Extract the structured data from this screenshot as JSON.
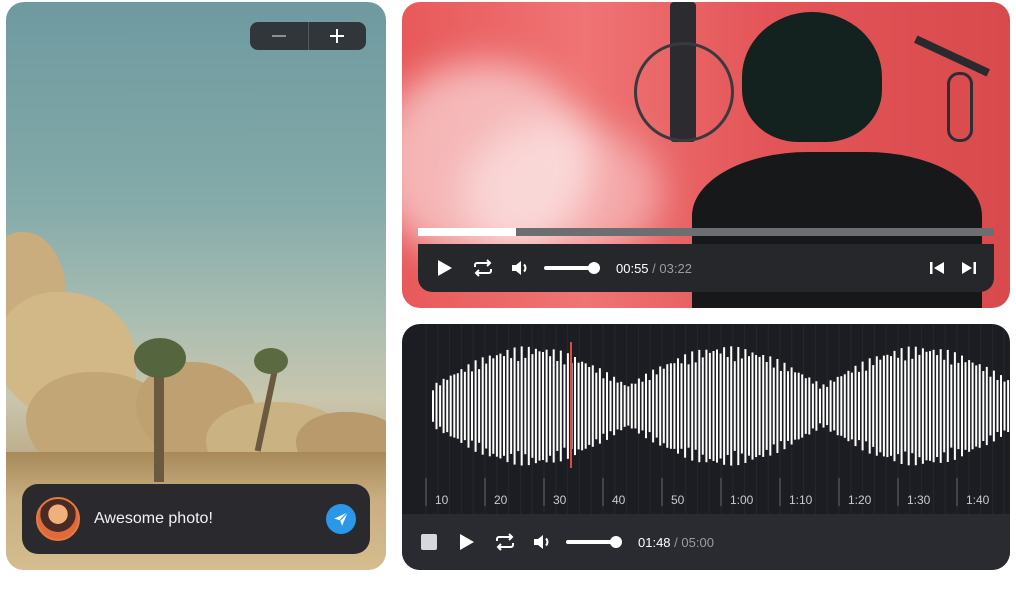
{
  "photo_card": {
    "zoom_out_icon": "minus-icon",
    "zoom_in_icon": "plus-icon",
    "comment": {
      "avatar_icon": "avatar",
      "text": "Awesome photo!",
      "send_icon": "paper-plane-icon",
      "send_color": "#2a97e8"
    }
  },
  "video_player": {
    "progress": 0.17,
    "current_time": "00:55",
    "separator": " / ",
    "duration": "03:22",
    "volume": 0.9,
    "controls": [
      "play-icon",
      "repeat-icon",
      "volume-icon",
      "skip-back-icon",
      "skip-forward-icon"
    ]
  },
  "audio_player": {
    "timeline_labels": [
      "10",
      "20",
      "30",
      "40",
      "50",
      "1:00",
      "1:10",
      "1:20",
      "1:30",
      "1:40"
    ],
    "playhead_color": "#e2483d",
    "current_time": "01:48",
    "separator": " / ",
    "duration": "05:00",
    "volume": 0.9,
    "controls": [
      "stop-icon",
      "play-icon",
      "repeat-icon",
      "volume-icon"
    ]
  }
}
